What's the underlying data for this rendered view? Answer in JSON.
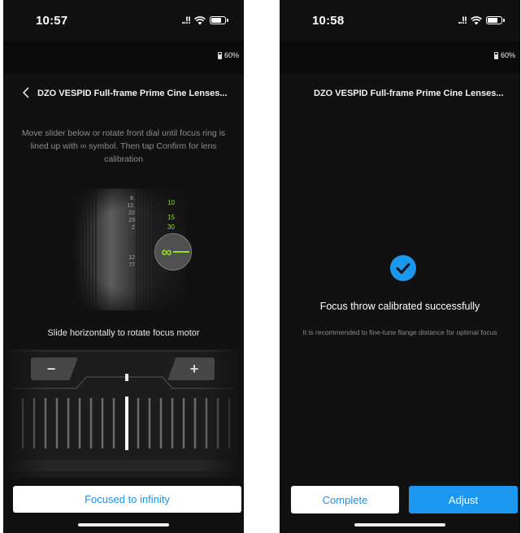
{
  "left_screen": {
    "status": {
      "time": "10:57",
      "signal": "..!!"
    },
    "battery_level": "60%",
    "title": "DZO VESPID Full-frame Prime Cine Lenses...",
    "instruction": "Move slider below or rotate front dial until focus ring is lined up with ∞ symbol. Then tap Confirm for lens calibration",
    "lens": {
      "scale_labels": [
        "10",
        "15",
        "30"
      ],
      "left_scale_labels": [
        "8.",
        "12.",
        "22",
        "23",
        "Z",
        "12",
        "77"
      ],
      "infinity_symbol": "∞"
    },
    "slide_label": "Slide horizontally to rotate focus motor",
    "minus_label": "−",
    "plus_label": "+",
    "primary_button": "Focused to infinity"
  },
  "right_screen": {
    "status": {
      "time": "10:58",
      "signal": "..!!"
    },
    "battery_level": "60%",
    "title": "DZO VESPID Full-frame Prime Cine Lenses...",
    "success_title": "Focus throw calibrated successfully",
    "success_description": "It is recommended to fine-tune flange distance for optimal focus",
    "complete_button": "Complete",
    "adjust_button": "Adjust"
  },
  "colors": {
    "accent_blue": "#1b97f0",
    "lens_green": "#8fe020",
    "background": "#111111"
  },
  "icons": [
    "chevron-left-icon",
    "wifi-icon",
    "battery-icon",
    "checkmark-circle-icon"
  ]
}
